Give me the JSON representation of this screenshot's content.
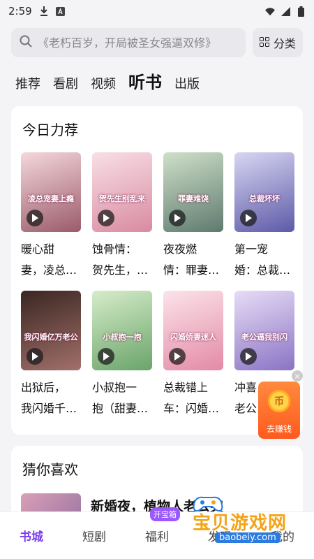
{
  "status_bar": {
    "time": "2:59",
    "icons": [
      "download-icon",
      "a-badge-icon",
      "wifi-icon",
      "signal-icon",
      "battery-icon"
    ]
  },
  "search": {
    "placeholder": "《老朽百岁，开局被圣女强逼双修》",
    "category_label": "分类"
  },
  "tabs": [
    {
      "label": "推荐",
      "active": false
    },
    {
      "label": "看剧",
      "active": false
    },
    {
      "label": "视频",
      "active": false
    },
    {
      "label": "听书",
      "active": true
    },
    {
      "label": "出版",
      "active": false
    }
  ],
  "recommend": {
    "title": "今日力荐",
    "books": [
      {
        "line1": "暖心甜",
        "line2": "妻，凌总…",
        "cover_text": "凌总宠妻上瘾",
        "colors": [
          "#f5d7dc",
          "#9a5b6a"
        ]
      },
      {
        "line1": "蚀骨情：",
        "line2": "贺先生，…",
        "cover_text": "贺先生别乱来",
        "colors": [
          "#f8dfe6",
          "#d98aa1"
        ]
      },
      {
        "line1": "夜夜燃",
        "line2": "情：罪妻…",
        "cover_text": "罪妻难饶",
        "colors": [
          "#cfe0c8",
          "#5e7a6f"
        ]
      },
      {
        "line1": "第一宠",
        "line2": "婚：总裁…",
        "cover_text": "总裁坏坏",
        "colors": [
          "#d8d6f2",
          "#5d5aa8"
        ]
      },
      {
        "line1": "出狱后，",
        "line2": "我闪婚千…",
        "cover_text": "我闪婚亿万老公",
        "colors": [
          "#3a2622",
          "#a2706a"
        ]
      },
      {
        "line1": "小叔抱一",
        "line2": "抱（甜妻…",
        "cover_text": "小叔抱一抱",
        "colors": [
          "#d6ecc9",
          "#6aa46a"
        ]
      },
      {
        "line1": "总裁错上",
        "line2": "车：闪婚…",
        "cover_text": "闪婚娇妻迷人",
        "colors": [
          "#fbe3ea",
          "#e38aa6"
        ]
      },
      {
        "line1": "冲喜",
        "line2": "老公…",
        "cover_text": "老公逼我别闪",
        "colors": [
          "#e7dcf6",
          "#8a74c4"
        ]
      }
    ]
  },
  "earn": {
    "coin_label": "币",
    "label": "去赚钱",
    "close": "×"
  },
  "guess": {
    "title": "猜你喜欢",
    "item_title": "新婚夜，植物人老公突"
  },
  "bottom_nav": {
    "items": [
      {
        "label": "书城",
        "active": true
      },
      {
        "label": "短剧",
        "active": false
      },
      {
        "label": "福利",
        "active": false
      },
      {
        "label": "发现",
        "active": false
      },
      {
        "label": "我的",
        "active": false
      }
    ],
    "badge": "开宝箱"
  },
  "watermark": {
    "text": "宝贝游戏网",
    "url": "baobeiy.com"
  },
  "colors": {
    "accent": "#7a3ff2",
    "background": "#f4f4f6"
  }
}
